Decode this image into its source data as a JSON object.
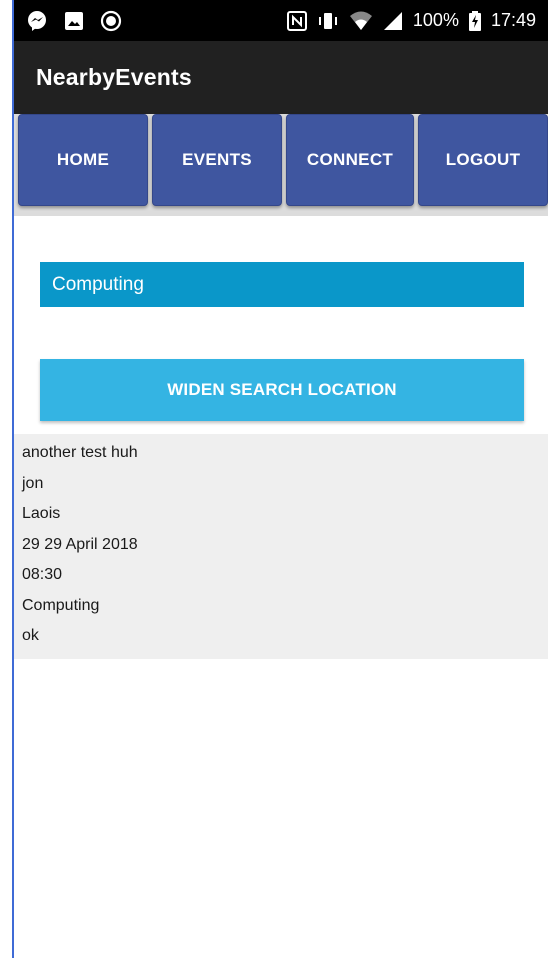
{
  "status_bar": {
    "time": "17:49",
    "battery": "100%",
    "left_icons": [
      "messenger-icon",
      "image-icon",
      "record-icon"
    ],
    "right_icons": [
      "nfc-icon",
      "vibrate-icon",
      "wifi-icon",
      "signal-icon",
      "battery-charging-icon"
    ]
  },
  "app_bar": {
    "title": "NearbyEvents"
  },
  "nav": {
    "items": [
      {
        "label": "HOME"
      },
      {
        "label": "EVENTS"
      },
      {
        "label": "CONNECT"
      },
      {
        "label": "LOGOUT"
      }
    ]
  },
  "category": {
    "value": "Computing"
  },
  "actions": {
    "widen_label": "WIDEN SEARCH LOCATION"
  },
  "event": {
    "lines": [
      "another test huh",
      "jon",
      "Laois",
      "29 29 April 2018",
      "08:30",
      "Computing",
      "ok"
    ]
  },
  "colors": {
    "nav_button": "#3f56a0",
    "category_bar": "#0a97c9",
    "widen_button": "#34b4e3",
    "app_bar": "#212121"
  }
}
